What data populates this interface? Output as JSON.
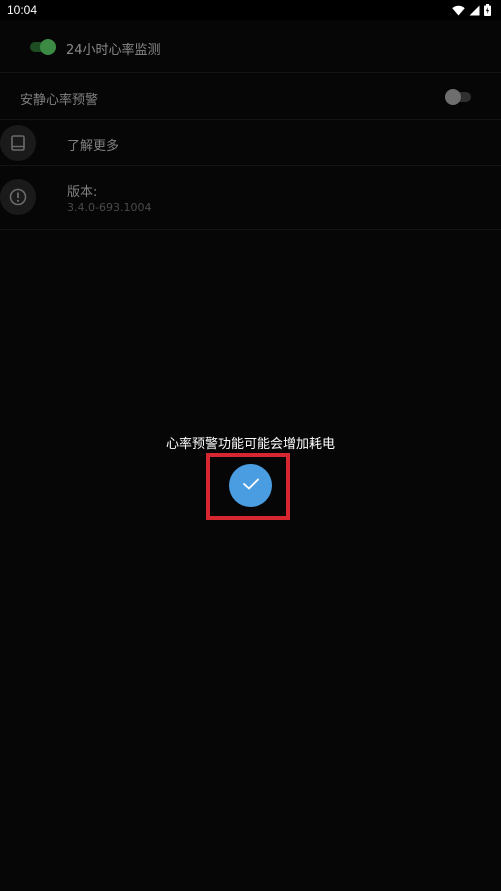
{
  "status_bar": {
    "time": "10:04",
    "icons": [
      "wifi-icon",
      "cellular-signal-icon",
      "battery-icon"
    ]
  },
  "settings": {
    "monitor_toggle_label": "24小时心率监测",
    "monitor_toggle_on": true,
    "warning_label": "安静心率预警",
    "warning_toggle_on": false,
    "learn_more_label": "了解更多",
    "learn_more_icon": "book-icon",
    "version_label": "版本:",
    "version_number": "3.4.0-693.1004",
    "version_icon": "info-icon"
  },
  "dialog": {
    "message": "心率预警功能可能会增加耗电",
    "confirm_icon": "checkmark-icon"
  },
  "colors": {
    "background": "#000000",
    "toggle_on": "#3b8b44",
    "toggle_off": "#6e6e6e",
    "confirm_button": "#4a9de0",
    "highlight": "#d62630"
  }
}
